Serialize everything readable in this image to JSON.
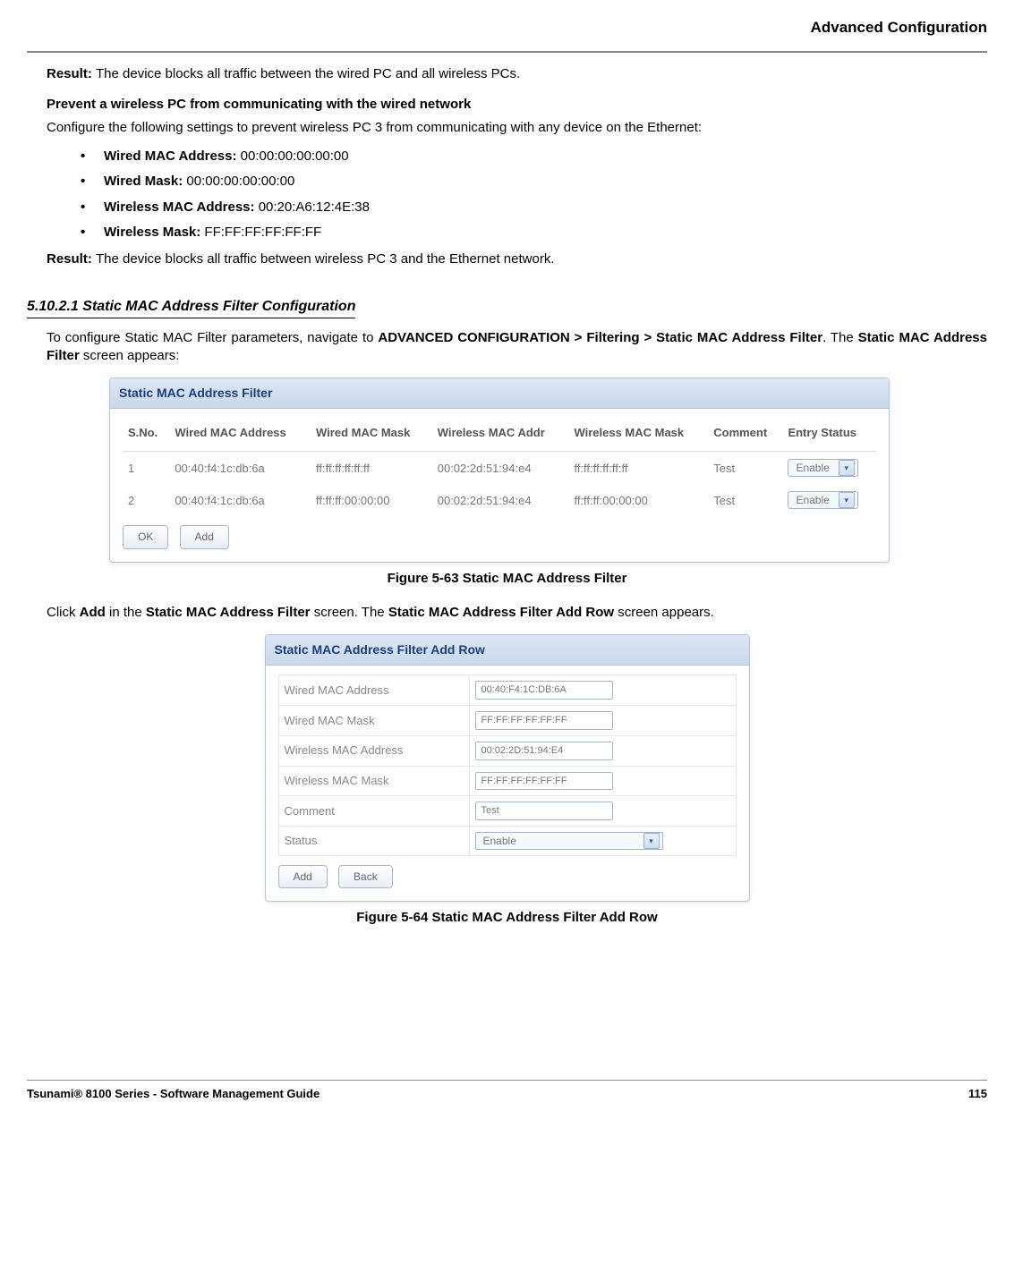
{
  "header": "Advanced Configuration",
  "result1_label": "Result: ",
  "result1_text": "The device blocks all traffic between the wired PC and all wireless PCs.",
  "prevent_heading": "Prevent a wireless PC from communicating with the wired network",
  "configure_line": "Configure the following settings to prevent wireless PC 3 from communicating with any device on the Ethernet:",
  "bullets": [
    {
      "label": "Wired MAC Address: ",
      "value": "00:00:00:00:00:00"
    },
    {
      "label": "Wired Mask: ",
      "value": "00:00:00:00:00:00"
    },
    {
      "label": "Wireless MAC Address: ",
      "value": "00:20:A6:12:4E:38"
    },
    {
      "label": "Wireless Mask: ",
      "value": "FF:FF:FF:FF:FF:FF"
    }
  ],
  "result2_label": "Result: ",
  "result2_text": "The device blocks all traffic between wireless PC 3 and the Ethernet network.",
  "section_number": "5.10.2.1 Static MAC Address Filter Configuration",
  "nav_pre": "To configure Static MAC Filter parameters, navigate to ",
  "nav_bold": "ADVANCED CONFIGURATION > Filtering > Static MAC Address Filter",
  "nav_post1": ". The ",
  "nav_bold2": "Static MAC Address Filter",
  "nav_post2": " screen appears:",
  "panel1": {
    "title": "Static MAC Address Filter",
    "headers": [
      "S.No.",
      "Wired MAC Address",
      "Wired MAC Mask",
      "Wireless MAC Addr",
      "Wireless MAC Mask",
      "Comment",
      "Entry Status"
    ],
    "rows": [
      {
        "sno": "1",
        "wmac": "00:40:f4:1c:db:6a",
        "wmask": "ff:ff:ff:ff:ff:ff",
        "wlmac": "00:02:2d:51:94:e4",
        "wlmask": "ff:ff:ff:ff:ff:ff",
        "comment": "Test",
        "status": "Enable"
      },
      {
        "sno": "2",
        "wmac": "00:40:f4:1c:db:6a",
        "wmask": "ff:ff:ff:00:00:00",
        "wlmac": "00:02:2d:51:94:e4",
        "wlmask": "ff:ff:ff:00:00:00",
        "comment": "Test",
        "status": "Enable"
      }
    ],
    "ok": "OK",
    "add": "Add"
  },
  "caption1": "Figure 5-63 Static MAC Address Filter",
  "click_pre": "Click ",
  "click_b1": "Add",
  "click_mid1": " in the ",
  "click_b2": "Static MAC Address Filter",
  "click_mid2": " screen. The ",
  "click_b3": "Static MAC Address Filter Add Row",
  "click_post": " screen appears.",
  "panel2": {
    "title": "Static MAC Address Filter Add Row",
    "fields": [
      {
        "label": "Wired MAC Address",
        "value": "00:40:F4:1C:DB:6A"
      },
      {
        "label": "Wired MAC Mask",
        "value": "FF:FF:FF:FF:FF:FF"
      },
      {
        "label": "Wireless MAC Address",
        "value": "00:02:2D:51:94:E4"
      },
      {
        "label": "Wireless MAC Mask",
        "value": "FF:FF:FF:FF:FF:FF"
      },
      {
        "label": "Comment",
        "value": "Test"
      }
    ],
    "status_label": "Status",
    "status_value": "Enable",
    "add": "Add",
    "back": "Back"
  },
  "caption2": "Figure 5-64 Static MAC Address Filter Add Row",
  "footer_left": "Tsunami® 8100 Series - Software Management Guide",
  "footer_right": "115"
}
